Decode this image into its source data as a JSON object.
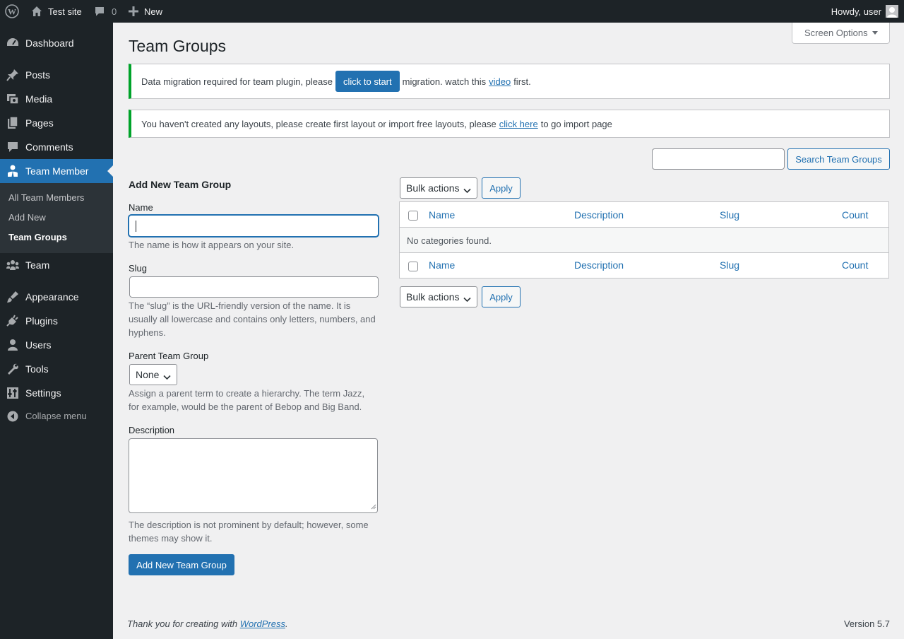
{
  "admin_bar": {
    "site_name": "Test site",
    "comments_count": "0",
    "new_label": "New",
    "greeting": "Howdy, user"
  },
  "menu": {
    "items": [
      {
        "label": "Dashboard",
        "icon": "dashboard-icon"
      },
      {
        "label": "Posts",
        "icon": "pin-icon"
      },
      {
        "label": "Media",
        "icon": "media-icon"
      },
      {
        "label": "Pages",
        "icon": "pages-icon"
      },
      {
        "label": "Comments",
        "icon": "comment-icon"
      },
      {
        "label": "Team Member",
        "icon": "team-member-icon",
        "current": true
      },
      {
        "label": "Team",
        "icon": "groups-icon"
      },
      {
        "label": "Appearance",
        "icon": "brush-icon"
      },
      {
        "label": "Plugins",
        "icon": "plugin-icon"
      },
      {
        "label": "Users",
        "icon": "user-icon"
      },
      {
        "label": "Tools",
        "icon": "wrench-icon"
      },
      {
        "label": "Settings",
        "icon": "settings-icon"
      }
    ],
    "submenu": [
      "All Team Members",
      "Add New",
      "Team Groups"
    ],
    "collapse_label": "Collapse menu"
  },
  "screen_options": "Screen Options",
  "page_title": "Team Groups",
  "notices": {
    "migration": {
      "text_before": "Data migration required for team plugin, please",
      "button": "click to start",
      "text_middle": "migration. watch this",
      "link": "video",
      "text_after": "first."
    },
    "layouts": {
      "text_before": "You haven't created any layouts, please create first layout or import free layouts, please",
      "link": "click here",
      "text_after": "to go import page"
    }
  },
  "search": {
    "value": "",
    "button": "Search Team Groups"
  },
  "form": {
    "heading": "Add New Team Group",
    "name_label": "Name",
    "name_value": "",
    "name_help": "The name is how it appears on your site.",
    "slug_label": "Slug",
    "slug_value": "",
    "slug_help_1": "The “slug” is the URL-friendly version of the name. It is",
    "slug_help_2": "usually all lowercase and contains only letters, numbers, and",
    "slug_help_3": "hyphens.",
    "parent_label": "Parent Team Group",
    "parent_value": "None",
    "parent_help_1": "Assign a parent term to create a hierarchy. The term Jazz,",
    "parent_help_2": "for example, would be the parent of Bebop and Big Band.",
    "description_label": "Description",
    "description_value": "",
    "description_help_1": "The description is not prominent by default; however, some",
    "description_help_2": "themes may show it.",
    "submit": "Add New Team Group"
  },
  "list": {
    "bulk_actions": "Bulk actions",
    "apply": "Apply",
    "columns": [
      "Name",
      "Description",
      "Slug",
      "Count"
    ],
    "empty_message": "No categories found."
  },
  "footer": {
    "thanks_before": "Thank you for creating with",
    "wordpress_link": "WordPress",
    "thanks_after": ".",
    "version": "Version 5.7"
  },
  "colors": {
    "admin_dark": "#1d2327",
    "accent": "#2271b1",
    "notice_success": "#00a32a"
  }
}
